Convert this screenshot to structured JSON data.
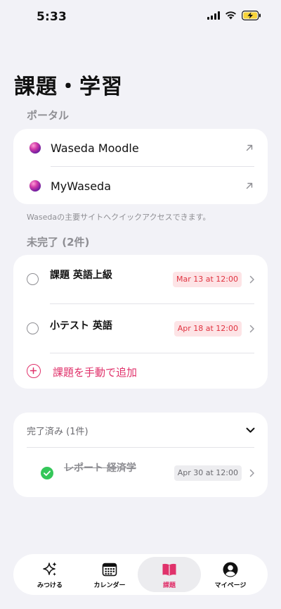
{
  "status_bar": {
    "time": "5:33"
  },
  "page": {
    "title": "課題・学習"
  },
  "portal": {
    "section_label": "ポータル",
    "items": [
      {
        "label": "Waseda Moodle"
      },
      {
        "label": "MyWaseda"
      }
    ],
    "note": "Wasedaの主要サイトへクイックアクセスできます。"
  },
  "incomplete": {
    "section_label": "未完了 (2件)",
    "tasks": [
      {
        "title": "課題 英語上級",
        "due": "Mar 13 at 12:00",
        "due_color": "#e0323f"
      },
      {
        "title": "小テスト 英語",
        "due": "Apr 18 at 12:00",
        "due_color": "#e0323f"
      }
    ],
    "add_label": "課題を手動で追加"
  },
  "completed": {
    "header": "完了済み (1件)",
    "tasks": [
      {
        "title": "レポート 経済学",
        "due": "Apr 30 at 12:00"
      }
    ]
  },
  "tab_bar": {
    "tabs": [
      {
        "label": "みつける",
        "icon": "sparkles-icon",
        "active": false
      },
      {
        "label": "カレンダー",
        "icon": "calendar-icon",
        "active": false
      },
      {
        "label": "課題",
        "icon": "book-icon",
        "active": true
      },
      {
        "label": "マイページ",
        "icon": "person-circle-icon",
        "active": false
      }
    ]
  },
  "colors": {
    "accent": "#e0326b",
    "overdue_red": "#e0323f",
    "complete_green": "#34c759",
    "background": "#f2f2f7"
  }
}
